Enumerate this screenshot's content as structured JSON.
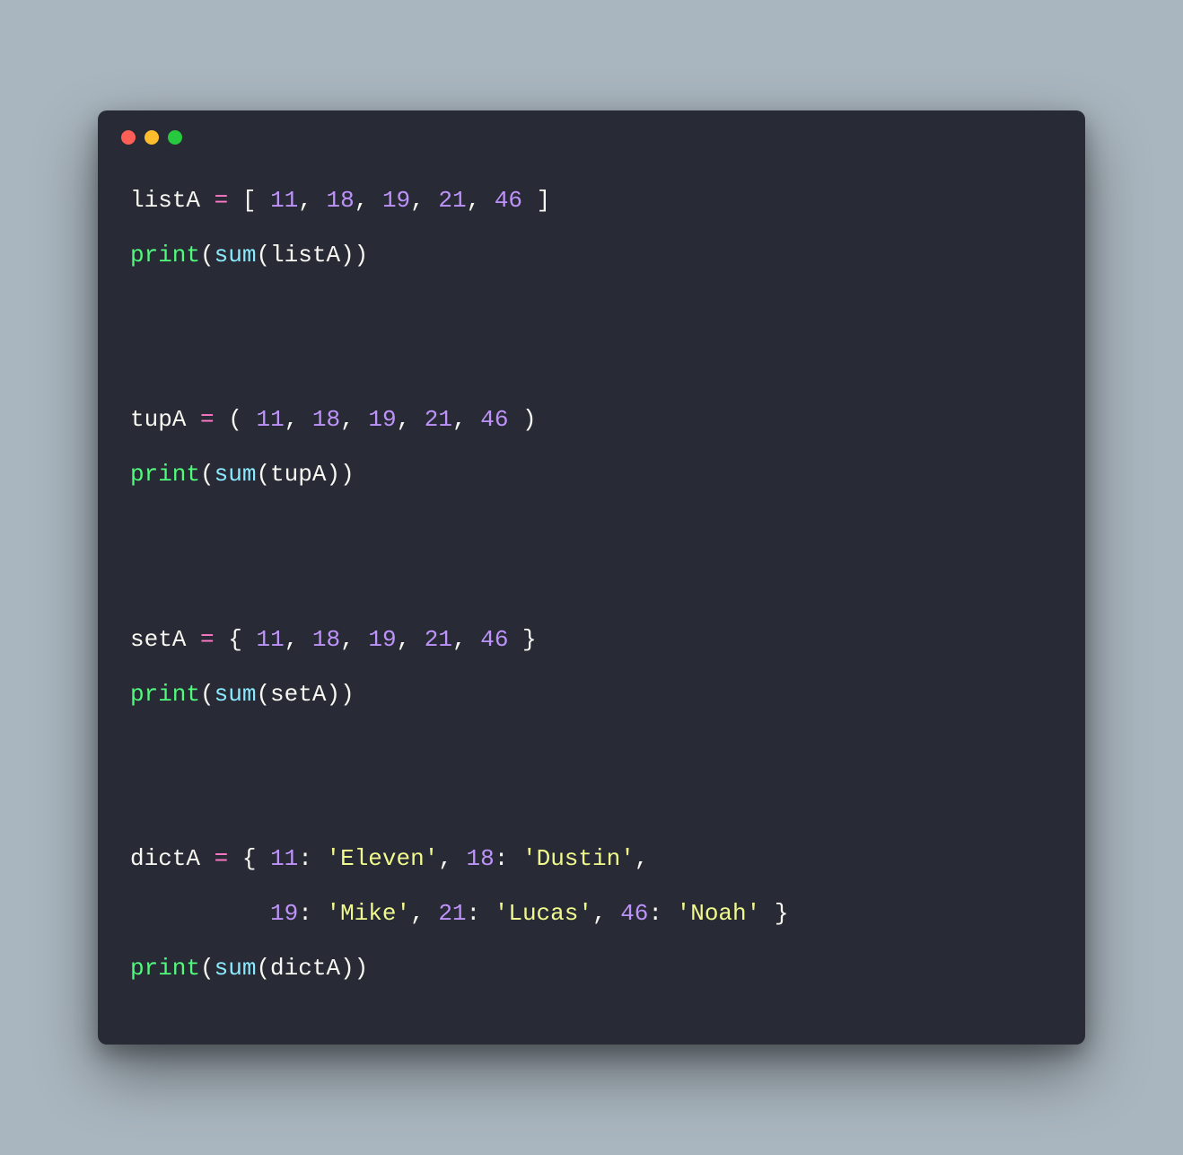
{
  "window": {
    "dots": {
      "red": "#ff5f56",
      "yellow": "#ffbd2e",
      "green": "#27c93f"
    },
    "bg": "#282a36"
  },
  "colors": {
    "ident": "#f8f8f2",
    "op": "#ff79c6",
    "num": "#bd93f9",
    "func": "#50fa7b",
    "builtin": "#8be9fd",
    "str": "#f1fa8c"
  },
  "code": {
    "listA": {
      "name": "listA",
      "eq": "=",
      "open": "[",
      "close": "]",
      "nums": [
        "11",
        "18",
        "19",
        "21",
        "46"
      ]
    },
    "printListA": {
      "print": "print",
      "sum": "sum",
      "arg": "listA"
    },
    "tupA": {
      "name": "tupA",
      "eq": "=",
      "open": "(",
      "close": ")",
      "nums": [
        "11",
        "18",
        "19",
        "21",
        "46"
      ]
    },
    "printTupA": {
      "print": "print",
      "sum": "sum",
      "arg": "tupA"
    },
    "setA": {
      "name": "setA",
      "eq": "=",
      "open": "{",
      "close": "}",
      "nums": [
        "11",
        "18",
        "19",
        "21",
        "46"
      ]
    },
    "printSetA": {
      "print": "print",
      "sum": "sum",
      "arg": "setA"
    },
    "dictA": {
      "name": "dictA",
      "eq": "=",
      "open": "{",
      "close": "}",
      "pairs_line1": [
        {
          "k": "11",
          "v": "'Eleven'"
        },
        {
          "k": "18",
          "v": "'Dustin'"
        }
      ],
      "indent": "          ",
      "pairs_line2": [
        {
          "k": "19",
          "v": "'Mike'"
        },
        {
          "k": "21",
          "v": "'Lucas'"
        },
        {
          "k": "46",
          "v": "'Noah'"
        }
      ]
    },
    "printDictA": {
      "print": "print",
      "sum": "sum",
      "arg": "dictA"
    },
    "comma": ",",
    "colon": ":",
    "lparen": "(",
    "rparen": ")"
  }
}
